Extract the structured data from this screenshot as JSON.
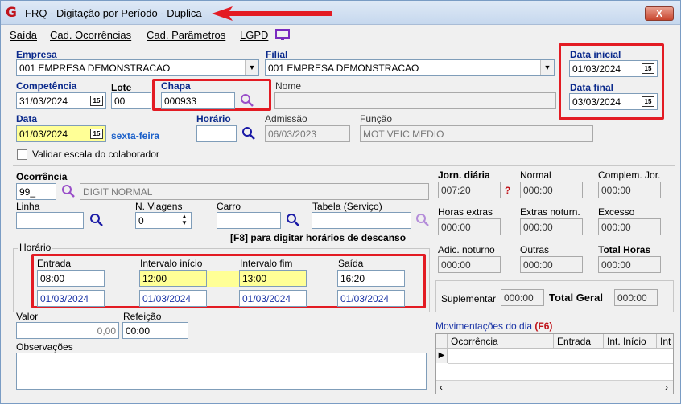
{
  "window": {
    "title": "FRQ - Digitação por Período - Duplica",
    "close_label": "X",
    "logo": "G"
  },
  "menu": [
    "Saída",
    "Cad. Ocorrências",
    "Cad. Parâmetros",
    "LGPD"
  ],
  "empresa": {
    "label": "Empresa",
    "value": "001 EMPRESA DEMONSTRACAO"
  },
  "filial": {
    "label": "Filial",
    "value": "001 EMPRESA DEMONSTRACAO"
  },
  "data_inicial": {
    "label": "Data inicial",
    "value": "01/03/2024"
  },
  "data_final": {
    "label": "Data final",
    "value": "03/03/2024"
  },
  "competencia": {
    "label": "Competência",
    "value": "31/03/2024"
  },
  "lote": {
    "label": "Lote",
    "value": "00"
  },
  "chapa": {
    "label": "Chapa",
    "value": "000933"
  },
  "nome": {
    "label": "Nome",
    "value": ""
  },
  "data": {
    "label": "Data",
    "value": "01/03/2024",
    "weekday": "sexta-feira"
  },
  "horario": {
    "label": "Horário",
    "value": ""
  },
  "admissao": {
    "label": "Admissão",
    "value": "06/03/2023"
  },
  "funcao": {
    "label": "Função",
    "value": "MOT VEIC MEDIO"
  },
  "validar": {
    "label": "Validar escala do colaborador"
  },
  "ocorrencia": {
    "label": "Ocorrência",
    "code": "99_",
    "desc": "DIGIT NORMAL"
  },
  "linha": {
    "label": "Linha",
    "value": ""
  },
  "viagens": {
    "label": "N. Viagens",
    "value": "0"
  },
  "carro": {
    "label": "Carro",
    "value": ""
  },
  "tabela": {
    "label": "Tabela (Serviço)",
    "value": ""
  },
  "f8_hint": "[F8] para digitar horários de descanso",
  "horario_group": {
    "legend": "Horário",
    "entrada": {
      "label": "Entrada",
      "time": "08:00",
      "date": "01/03/2024"
    },
    "int_inicio": {
      "label": "Intervalo início",
      "time": "12:00",
      "date": "01/03/2024"
    },
    "int_fim": {
      "label": "Intervalo fim",
      "time": "13:00",
      "date": "01/03/2024"
    },
    "saida": {
      "label": "Saída",
      "time": "16:20",
      "date": "01/03/2024"
    }
  },
  "valor": {
    "label": "Valor",
    "value": "0,00"
  },
  "refeicao": {
    "label": "Refeição",
    "value": "00:00"
  },
  "observacoes": {
    "label": "Observações",
    "value": ""
  },
  "totals": {
    "jorn_diaria": {
      "label": "Jorn. diária",
      "value": "007:20",
      "help": "?"
    },
    "normal": {
      "label": "Normal",
      "value": "000:00"
    },
    "complem": {
      "label": "Complem. Jor.",
      "value": "000:00"
    },
    "horas_extras": {
      "label": "Horas extras",
      "value": "000:00"
    },
    "extras_noturn": {
      "label": "Extras noturn.",
      "value": "000:00"
    },
    "excesso": {
      "label": "Excesso",
      "value": "000:00"
    },
    "adic_noturno": {
      "label": "Adic. noturno",
      "value": "000:00"
    },
    "outras": {
      "label": "Outras",
      "value": "000:00"
    },
    "total_horas": {
      "label": "Total Horas",
      "value": "000:00"
    },
    "suplementar": {
      "label": "Suplementar",
      "value": "000:00"
    },
    "total_geral": {
      "label": "Total Geral",
      "value": "000:00"
    }
  },
  "movimentacoes": {
    "title": "Movimentações do dia",
    "hotkey": "(F6)",
    "columns": [
      "Ocorrência",
      "Entrada",
      "Int. Início",
      "Int"
    ]
  }
}
